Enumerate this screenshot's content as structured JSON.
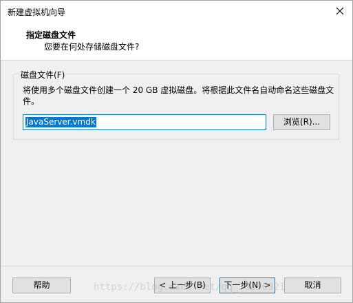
{
  "window": {
    "title": "新建虚拟机向导"
  },
  "header": {
    "title": "指定磁盘文件",
    "subtitle": "您要在何处存储磁盘文件?"
  },
  "disk_file_group": {
    "legend": "磁盘文件(F)",
    "description": "将使用多个磁盘文件创建一个 20 GB 虚拟磁盘。将根据此文件名自动命名这些磁盘文件。",
    "file_name_value": "JavaServer.vmdk",
    "browse_label": "浏览(R)..."
  },
  "footer": {
    "help_label": "帮助",
    "back_label": "< 上一步(B)",
    "next_label": "下一步(N) >",
    "cancel_label": "取消"
  },
  "watermark": "https://blog.csdn.net/qq_38336921",
  "colors": {
    "accent": "#0078d7",
    "dialog_background": "#f0f0f0",
    "button_background": "#e1e1e1"
  },
  "icons": {
    "close": "close-icon"
  }
}
